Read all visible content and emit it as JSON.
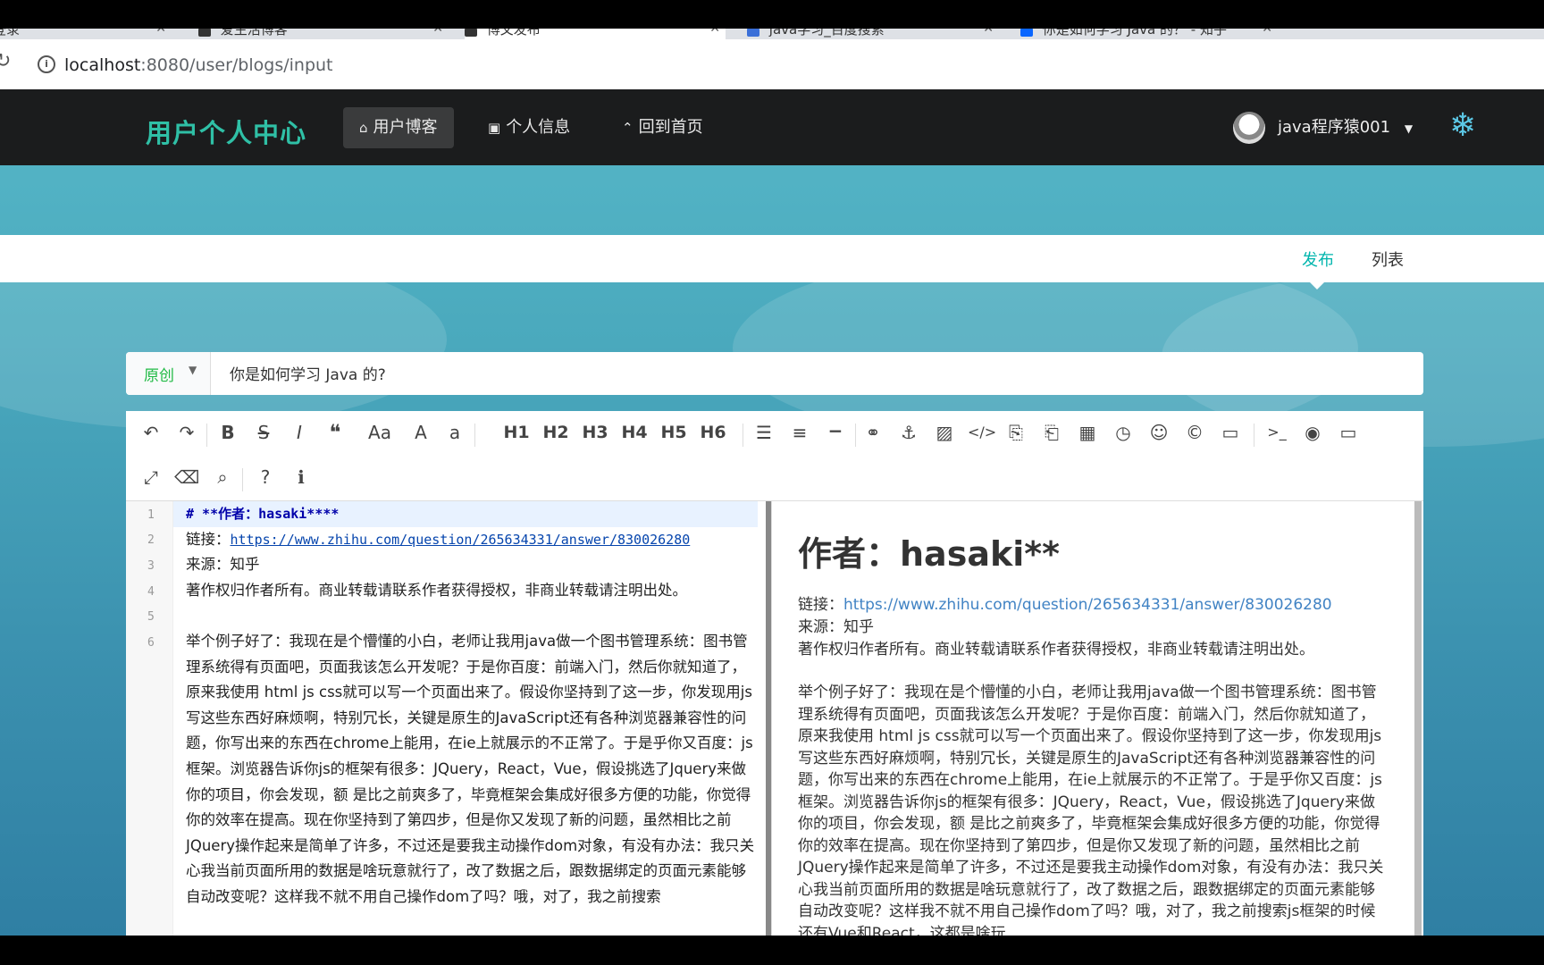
{
  "browser": {
    "tabs": [
      {
        "label": "登录"
      },
      {
        "label": "爱生活博客"
      },
      {
        "label": "博文发布"
      },
      {
        "label": "java学习_百度搜索"
      },
      {
        "label": "你是如何学习 Java 的？ - 知乎"
      }
    ],
    "url_host": "localhost",
    "url_path": ":8080/user/blogs/input"
  },
  "nav": {
    "brand": "用户个人中心",
    "items": [
      {
        "label": "用户博客",
        "icon": "home-icon"
      },
      {
        "label": "个人信息",
        "icon": "image-icon"
      },
      {
        "label": "回到首页",
        "icon": "up-arrow-icon"
      }
    ],
    "user": "java程序猿001"
  },
  "subnav": {
    "publish": "发布",
    "list": "列表"
  },
  "form": {
    "type": "原创",
    "title": "你是如何学习 Java 的?"
  },
  "toolbar": {
    "headings": [
      "H1",
      "H2",
      "H3",
      "H4",
      "H5",
      "H6"
    ]
  },
  "editor": {
    "line_numbers": [
      "1",
      "2",
      "3",
      "4",
      "5",
      "6"
    ],
    "line1": "# **作者：hasaki****",
    "line2_prefix": "链接：",
    "line2_url": "https://www.zhihu.com/question/265634331/answer/830026280",
    "line3": "来源：知乎",
    "line4": "著作权归作者所有。商业转载请联系作者获得授权，非商业转载请注明出处。",
    "line6": "举个例子好了：我现在是个懵懂的小白，老师让我用java做一个图书管理系统：图书管理系统得有页面吧，页面我该怎么开发呢？于是你百度：前端入门，然后你就知道了，原来我使用 html js css就可以写一个页面出来了。假设你坚持到了这一步，你发现用js写这些东西好麻烦啊，特别冗长，关键是原生的JavaScript还有各种浏览器兼容性的问题，你写出来的东西在chrome上能用，在ie上就展示的不正常了。于是乎你又百度：js框架。浏览器告诉你js的框架有很多：JQuery，React，Vue，假设挑选了Jquery来做你的项目，你会发现，额 是比之前爽多了，毕竟框架会集成好很多方便的功能，你觉得你的效率在提高。现在你坚持到了第四步，但是你又发现了新的问题，虽然相比之前JQuery操作起来是简单了许多，不过还是要我主动操作dom对象，有没有办法：我只关心我当前页面所用的数据是啥玩意就行了，改了数据之后，跟数据绑定的页面元素能够自动改变呢？这样我不就不用自己操作dom了吗？哦，对了，我之前搜索"
  },
  "preview": {
    "heading": "作者：hasaki**",
    "link_prefix": "链接：",
    "link": "https://www.zhihu.com/question/265634331/answer/830026280",
    "source": "来源：知乎",
    "copyright": "著作权归作者所有。商业转载请联系作者获得授权，非商业转载请注明出处。",
    "body": "举个例子好了：我现在是个懵懂的小白，老师让我用java做一个图书管理系统：图书管理系统得有页面吧，页面我该怎么开发呢？于是你百度：前端入门，然后你就知道了，原来我使用 html js css就可以写一个页面出来了。假设你坚持到了这一步，你发现用js写这些东西好麻烦啊，特别冗长，关键是原生的JavaScript还有各种浏览器兼容性的问题，你写出来的东西在chrome上能用，在ie上就展示的不正常了。于是乎你又百度：js框架。浏览器告诉你js的框架有很多：JQuery，React，Vue，假设挑选了Jquery来做你的项目，你会发现，额 是比之前爽多了，毕竟框架会集成好很多方便的功能，你觉得你的效率在提高。现在你坚持到了第四步，但是你又发现了新的问题，虽然相比之前JQuery操作起来是简单了许多，不过还是要我主动操作dom对象，有没有办法：我只关心我当前页面所用的数据是啥玩意就行了，改了数据之后，跟数据绑定的页面元素能够自动改变呢？这样我不就不用自己操作dom了吗？哦，对了，我之前搜索js框架的时候还有Vue和React，这都是啥玩"
  },
  "colors": {
    "brand": "#2fc0a6",
    "active_subnav": "#00b5ad",
    "original_label": "#21ba45",
    "link": "#4183c4"
  }
}
